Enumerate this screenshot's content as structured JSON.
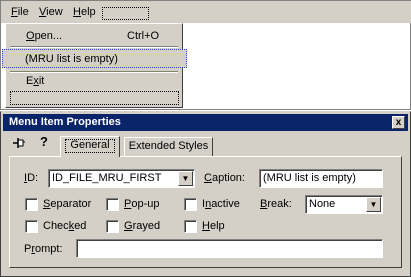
{
  "menubar": {
    "items": [
      {
        "pre": "",
        "key": "F",
        "post": "ile"
      },
      {
        "pre": "",
        "key": "V",
        "post": "iew"
      },
      {
        "pre": "",
        "key": "H",
        "post": "elp"
      }
    ]
  },
  "dropdown": {
    "open": {
      "pre": "",
      "key": "O",
      "post": "pen..."
    },
    "open_shortcut": "Ctrl+O",
    "mru_label": "(MRU list is empty)",
    "exit": {
      "pre": "E",
      "key": "x",
      "post": "it"
    }
  },
  "dialog": {
    "title": "Menu Item Properties",
    "close_glyph": "x",
    "pin_glyph": "⊣",
    "help_glyph": "?",
    "tabs": {
      "general": "General",
      "extended": "Extended Styles"
    },
    "id_label": {
      "pre": "",
      "key": "I",
      "post": "D:"
    },
    "id_value": "ID_FILE_MRU_FIRST",
    "caption_label": {
      "pre": "",
      "key": "C",
      "post": "aption:"
    },
    "caption_value": "(MRU list is empty)",
    "checkboxes": {
      "separator": {
        "pre": "",
        "key": "S",
        "post": "eparator"
      },
      "popup": {
        "pre": "",
        "key": "P",
        "post": "op-up"
      },
      "inactive": {
        "pre": "I",
        "key": "n",
        "post": "active"
      },
      "checked": {
        "pre": "Chec",
        "key": "k",
        "post": "ed"
      },
      "grayed": {
        "pre": "",
        "key": "G",
        "post": "rayed"
      },
      "help": {
        "pre": "",
        "key": "H",
        "post": "elp"
      }
    },
    "break_label": {
      "pre": "",
      "key": "B",
      "post": "reak:"
    },
    "break_value": "None",
    "prompt_label": {
      "pre": "P",
      "key": "r",
      "post": "ompt:"
    },
    "prompt_value": "",
    "combo_arrow": "▼"
  }
}
